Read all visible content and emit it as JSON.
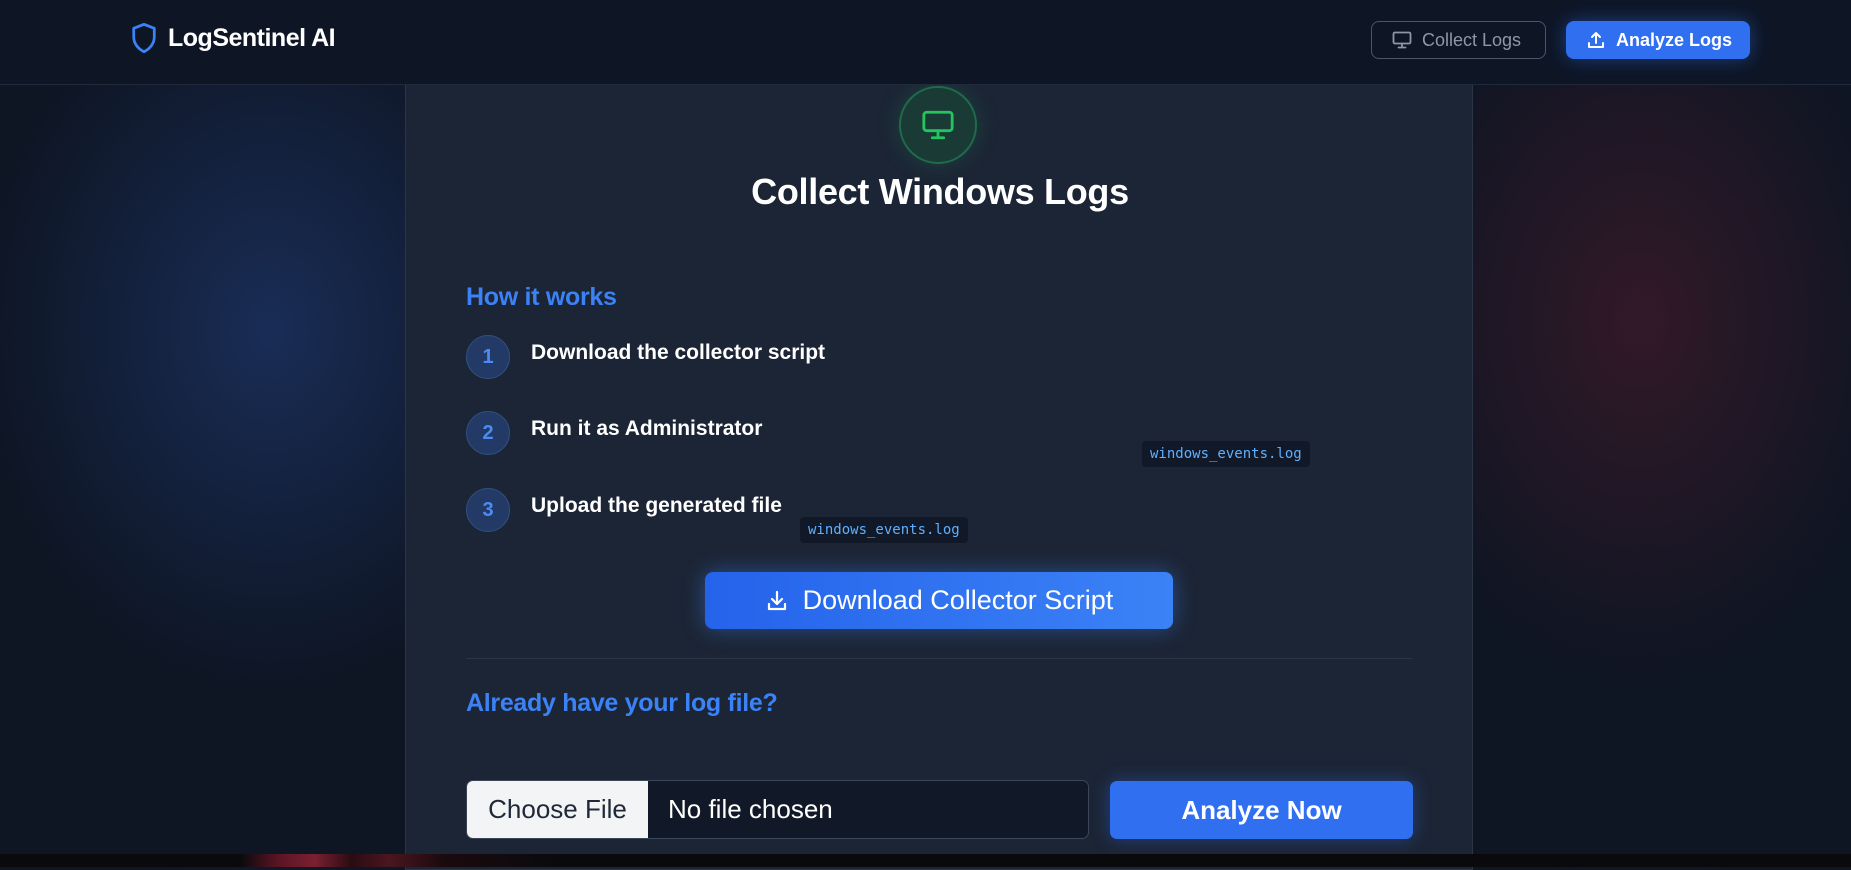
{
  "header": {
    "brand": "LogSentinel AI",
    "nav": {
      "collect_label": "Collect Logs",
      "analyze_label": "Analyze Logs"
    }
  },
  "card": {
    "title": "Collect Windows Logs",
    "how_title": "How it works",
    "steps": [
      {
        "num": "1",
        "text": "Download the collector script"
      },
      {
        "num": "2",
        "text": "Run it as Administrator"
      },
      {
        "num": "3",
        "text": "Upload the generated file"
      }
    ],
    "file_chips": [
      "windows_events.log",
      "windows_events.log"
    ],
    "download_label": "Download Collector Script",
    "already_title": "Already have your log file?",
    "choose_file_label": "Choose File",
    "file_status": "No file chosen",
    "analyze_now_label": "Analyze Now"
  },
  "icons": {
    "brand": "shield-icon",
    "collect": "monitor-icon",
    "analyze": "upload-icon",
    "card": "monitor-icon",
    "download": "download-icon"
  },
  "colors": {
    "accent": "#3b82f6",
    "button": "#2f6ff0",
    "card_bg": "#1c2535",
    "page_bg": "#0e1523",
    "icon_green": "#22c55e"
  }
}
